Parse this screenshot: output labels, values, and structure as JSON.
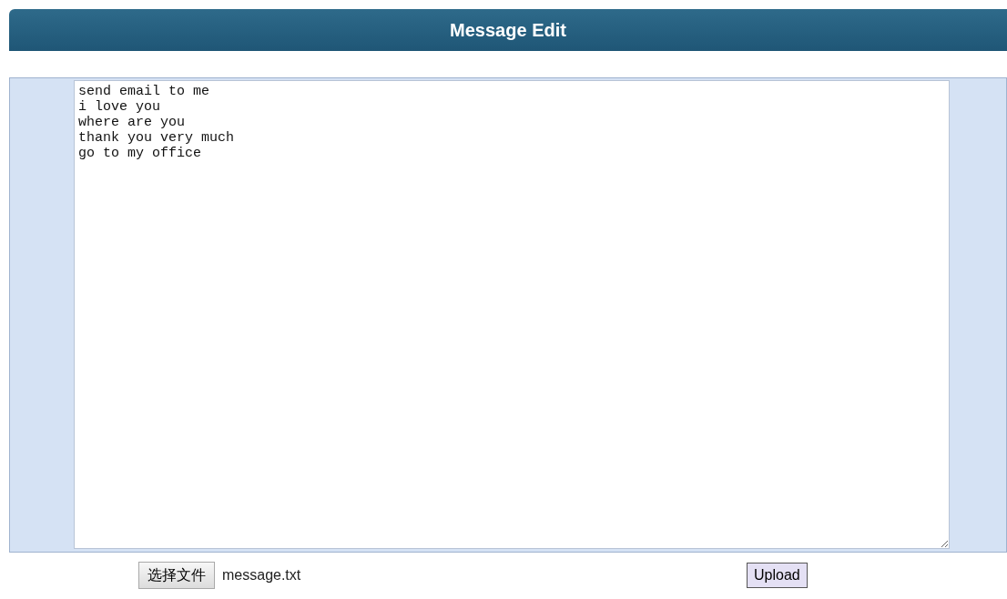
{
  "header": {
    "title": "Message Edit"
  },
  "message_field": {
    "value": "send email to me\ni love you\nwhere are you\nthank you very much\ngo to my office"
  },
  "file_picker": {
    "button": "选择文件",
    "file_name": "message.txt"
  },
  "upload_button": "Upload"
}
